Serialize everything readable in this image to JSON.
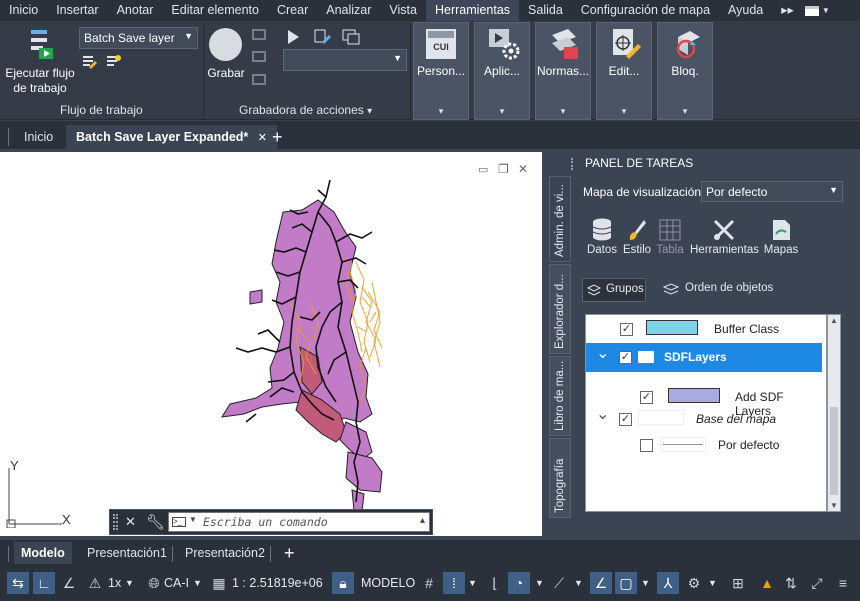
{
  "menubar": {
    "items": [
      "Inicio",
      "Insertar",
      "Anotar",
      "Editar elemento",
      "Crear",
      "Analizar",
      "Vista",
      "Herramientas",
      "Salida",
      "Configuración de mapa",
      "Ayuda"
    ],
    "active": "Herramientas",
    "overflow_icon": "double-chevron-right-icon"
  },
  "ribbon": {
    "run_workflow_label": "Ejecutar flujo de trabajo",
    "workflow_combo_value": "Batch Save layer",
    "workflow_panel_label": "Flujo de trabajo",
    "record_label": "Grabar",
    "recorder_panel_label": "Grabadora de acciones",
    "recorder_panel_arrow": "▾",
    "big_buttons": [
      {
        "label": "Person...",
        "icon": "cui-icon"
      },
      {
        "label": "Aplic...",
        "icon": "applications-gear-icon"
      },
      {
        "label": "Normas...",
        "icon": "standards-icon"
      },
      {
        "label": "Edit...",
        "icon": "edit-doc-icon"
      },
      {
        "label": "Bloq.",
        "icon": "block-icon"
      }
    ],
    "big_button_arrow": "▾",
    "cui_text": "CUI"
  },
  "doctabs": {
    "home": "Inicio",
    "active": "Batch Save Layer Expanded*",
    "close": "✕",
    "add": "+"
  },
  "viewport": {
    "axis_y": "Y",
    "axis_x": "X",
    "win_controls": [
      "▭",
      "❐",
      "✕"
    ]
  },
  "command_line": {
    "placeholder": "Escriba un comando",
    "close": "✕",
    "arrow": "▴"
  },
  "taskpanel": {
    "title": "PANEL DE TAREAS",
    "side_tabs": [
      "Admin. de vi...",
      "Explorador d...",
      "Libro de ma...",
      "Topografía"
    ],
    "view_map_label": "Mapa de visualización:",
    "view_map_value": "Por defecto",
    "tools": [
      "Datos",
      "Estilo",
      "Tabla",
      "Herramientas",
      "Mapas"
    ],
    "groups_label": "Grupos",
    "draw_order_label": "Orden de objetos",
    "tree": [
      {
        "label": "Buffer Class",
        "checked": true,
        "swatch": "#7fd3e8",
        "indent": 1
      },
      {
        "label": "SDFLayers",
        "checked": true,
        "folder": true,
        "selected": true,
        "indent": 0
      },
      {
        "label": "Add SDF Layers",
        "checked": true,
        "swatch": "#a7abe0",
        "indent": 1
      },
      {
        "label": "Base del mapa",
        "checked": true,
        "italic": true,
        "indent": 0
      },
      {
        "label": "Por defecto",
        "checked": false,
        "indent": 1
      }
    ],
    "check_mark": "✓",
    "expand_mark": "⌄"
  },
  "model_tabs": {
    "items": [
      "Modelo",
      "Presentación1",
      "Presentación2"
    ],
    "active": "Modelo",
    "add": "+"
  },
  "statusbar": {
    "scale_x": "1x",
    "coord_system": "CA-I",
    "scale": "1 : 2.51819e+06",
    "model": "MODELO"
  },
  "colors": {
    "accent": "#3e6fa8",
    "selection": "#1e88e5",
    "map_fill": "#c27bc7",
    "map_dark": "#c25a7a",
    "river": "#111111",
    "orange_lines": "#f39a1e"
  }
}
